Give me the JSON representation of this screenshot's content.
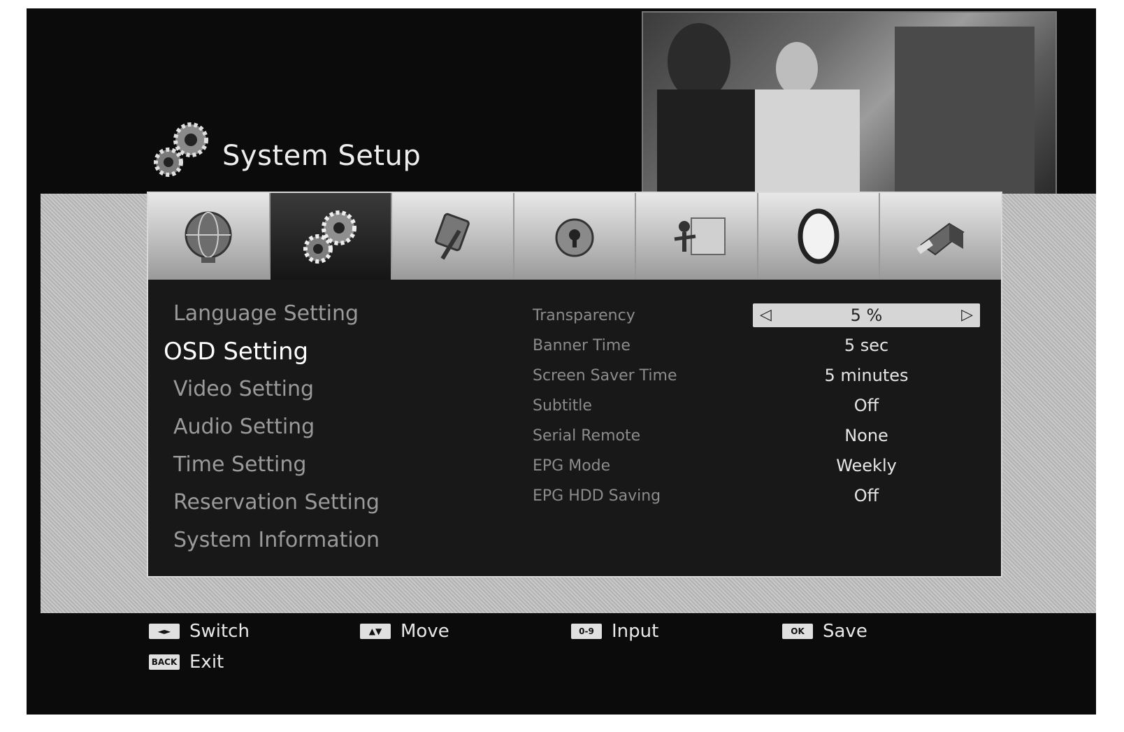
{
  "header": {
    "title": "System Setup",
    "title_icon": "gears-icon"
  },
  "preview": {
    "label": ""
  },
  "tabs": [
    {
      "icon": "globe-icon",
      "active": false
    },
    {
      "icon": "gears-icon",
      "active": true
    },
    {
      "icon": "tools-icon",
      "active": false
    },
    {
      "icon": "lock-icon",
      "active": false
    },
    {
      "icon": "installation-icon",
      "active": false
    },
    {
      "icon": "ring-icon",
      "active": false
    },
    {
      "icon": "usb-icon",
      "active": false
    }
  ],
  "left_menu": {
    "selected_index": 1,
    "items": [
      "Language Setting",
      "OSD Setting",
      "Video Setting",
      "Audio Setting",
      "Time Setting",
      "Reservation Setting",
      "System Information"
    ]
  },
  "settings": {
    "selected_index": 0,
    "rows": [
      {
        "label": "Transparency",
        "value": "5 %"
      },
      {
        "label": "Banner Time",
        "value": "5 sec"
      },
      {
        "label": "Screen Saver Time",
        "value": "5 minutes"
      },
      {
        "label": "Subtitle",
        "value": "Off"
      },
      {
        "label": "Serial Remote",
        "value": "None"
      },
      {
        "label": "EPG Mode",
        "value": "Weekly"
      },
      {
        "label": "EPG HDD Saving",
        "value": "Off"
      }
    ]
  },
  "hints": [
    {
      "key": "◄►",
      "label": "Switch"
    },
    {
      "key": "▲▼",
      "label": "Move"
    },
    {
      "key": "0-9",
      "label": "Input"
    },
    {
      "key": "OK",
      "label": "Save"
    },
    {
      "key": "BACK",
      "label": "Exit"
    }
  ]
}
